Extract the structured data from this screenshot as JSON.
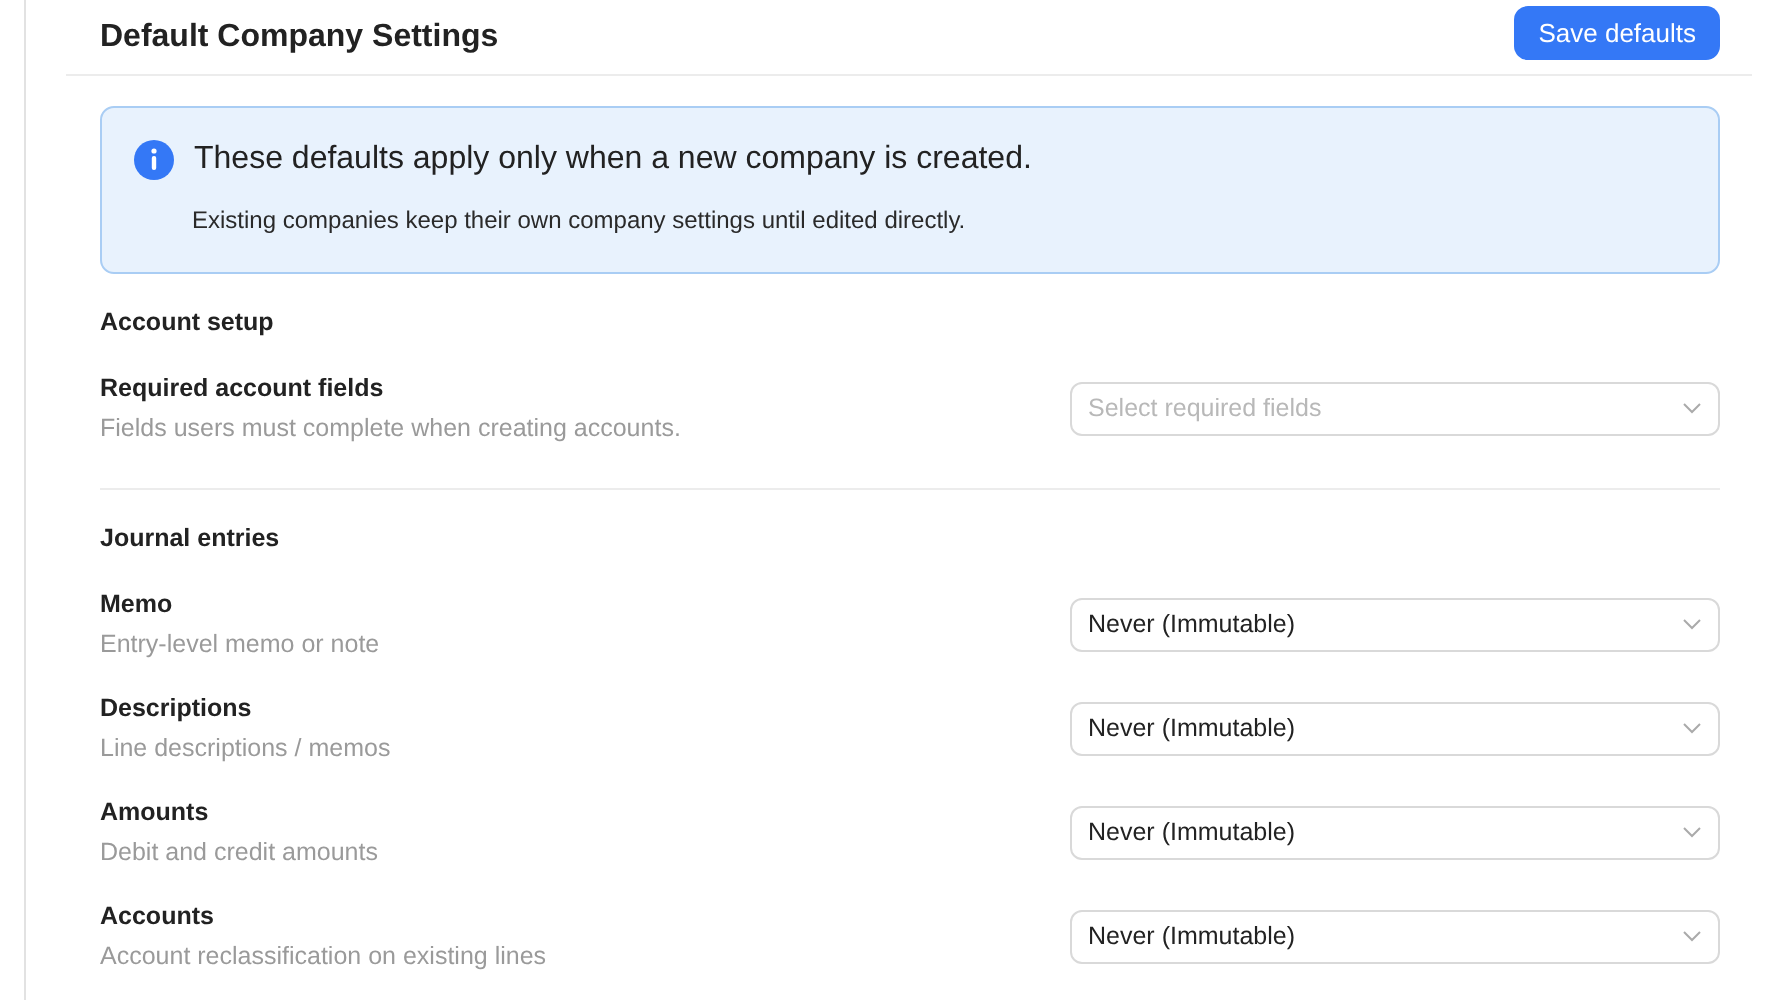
{
  "header": {
    "title": "Default Company Settings",
    "button": "Save defaults"
  },
  "notice": {
    "title": "These defaults apply only when a new company is created.",
    "body": "Existing companies keep their own company settings until edited directly."
  },
  "sections": [
    {
      "title": "Account setup",
      "settings": [
        {
          "label": "Required account fields",
          "description": "Fields users must complete when creating accounts.",
          "placeholder": "Select required fields"
        }
      ]
    },
    {
      "title": "Journal entries",
      "settings": [
        {
          "label": "Memo",
          "description": "Entry-level memo or note",
          "value": "Never (Immutable)"
        },
        {
          "label": "Descriptions",
          "description": "Line descriptions / memos",
          "value": "Never (Immutable)"
        },
        {
          "label": "Amounts",
          "description": "Debit and credit amounts",
          "value": "Never (Immutable)"
        },
        {
          "label": "Accounts",
          "description": "Account reclassification on existing lines",
          "value": "Never (Immutable)"
        }
      ]
    }
  ]
}
